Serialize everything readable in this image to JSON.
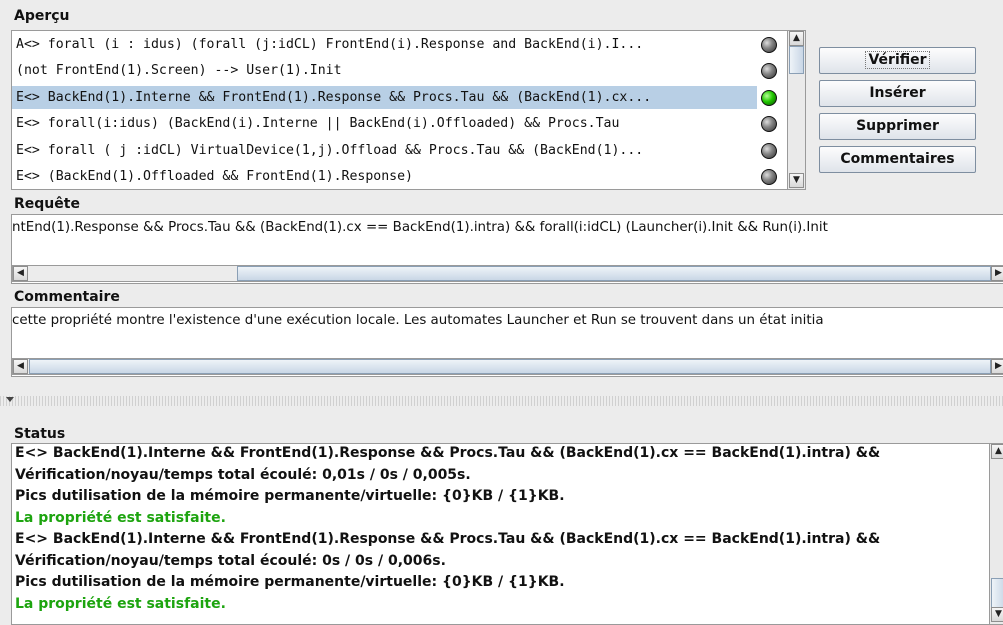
{
  "sections": {
    "apercu": "Aperçu",
    "requete": "Requête",
    "commentaire": "Commentaire",
    "status": "Status"
  },
  "queries": [
    {
      "text": "A<>  forall (i : idus) (forall (j:idCL) FrontEnd(i).Response and BackEnd(i).I...",
      "bulb": "grey",
      "selected": false
    },
    {
      "text": "(not FrontEnd(1).Screen) --> User(1).Init",
      "bulb": "grey",
      "selected": false
    },
    {
      "text": "E<> BackEnd(1).Interne && FrontEnd(1).Response && Procs.Tau && (BackEnd(1).cx...",
      "bulb": "green",
      "selected": true
    },
    {
      "text": "E<> forall(i:idus) (BackEnd(i).Interne || BackEnd(i).Offloaded) && Procs.Tau",
      "bulb": "grey",
      "selected": false
    },
    {
      "text": "E<> forall ( j :idCL) VirtualDevice(1,j).Offload && Procs.Tau &&  (BackEnd(1)...",
      "bulb": "grey",
      "selected": false
    },
    {
      "text": "E<> (BackEnd(1).Offloaded && FrontEnd(1).Response)",
      "bulb": "grey",
      "selected": false
    }
  ],
  "buttons": {
    "verifier": "Vérifier",
    "inserer": "Insérer",
    "supprimer": "Supprimer",
    "commentaires": "Commentaires"
  },
  "requete_text": "ntEnd(1).Response && Procs.Tau && (BackEnd(1).cx == BackEnd(1).intra) && forall(i:idCL) (Launcher(i).Init && Run(i).Init",
  "commentaire_text": "cette propriété montre l'existence d'une exécution locale. Les automates Launcher et Run se trouvent dans un état initia",
  "status_lines": [
    {
      "text": "E<> BackEnd(1).Interne && FrontEnd(1).Response && Procs.Tau && (BackEnd(1).cx == BackEnd(1).intra) &&",
      "ok": false
    },
    {
      "text": "Vérification/noyau/temps total écoulé: 0,01s / 0s / 0,005s.",
      "ok": false
    },
    {
      "text": "Pics dutilisation de la mémoire permanente/virtuelle: {0}KB / {1}KB.",
      "ok": false
    },
    {
      "text": "La propriété est satisfaite.",
      "ok": true
    },
    {
      "text": "E<> BackEnd(1).Interne && FrontEnd(1).Response && Procs.Tau && (BackEnd(1).cx == BackEnd(1).intra) &&",
      "ok": false
    },
    {
      "text": "Vérification/noyau/temps total écoulé: 0s / 0s / 0,006s.",
      "ok": false
    },
    {
      "text": "Pics dutilisation de la mémoire permanente/virtuelle: {0}KB / {1}KB.",
      "ok": false
    },
    {
      "text": "La propriété est satisfaite.",
      "ok": true
    }
  ],
  "colors": {
    "selection": "#b8cfe5",
    "ok_text": "#1da40f",
    "bulb_green": "#22c800"
  }
}
